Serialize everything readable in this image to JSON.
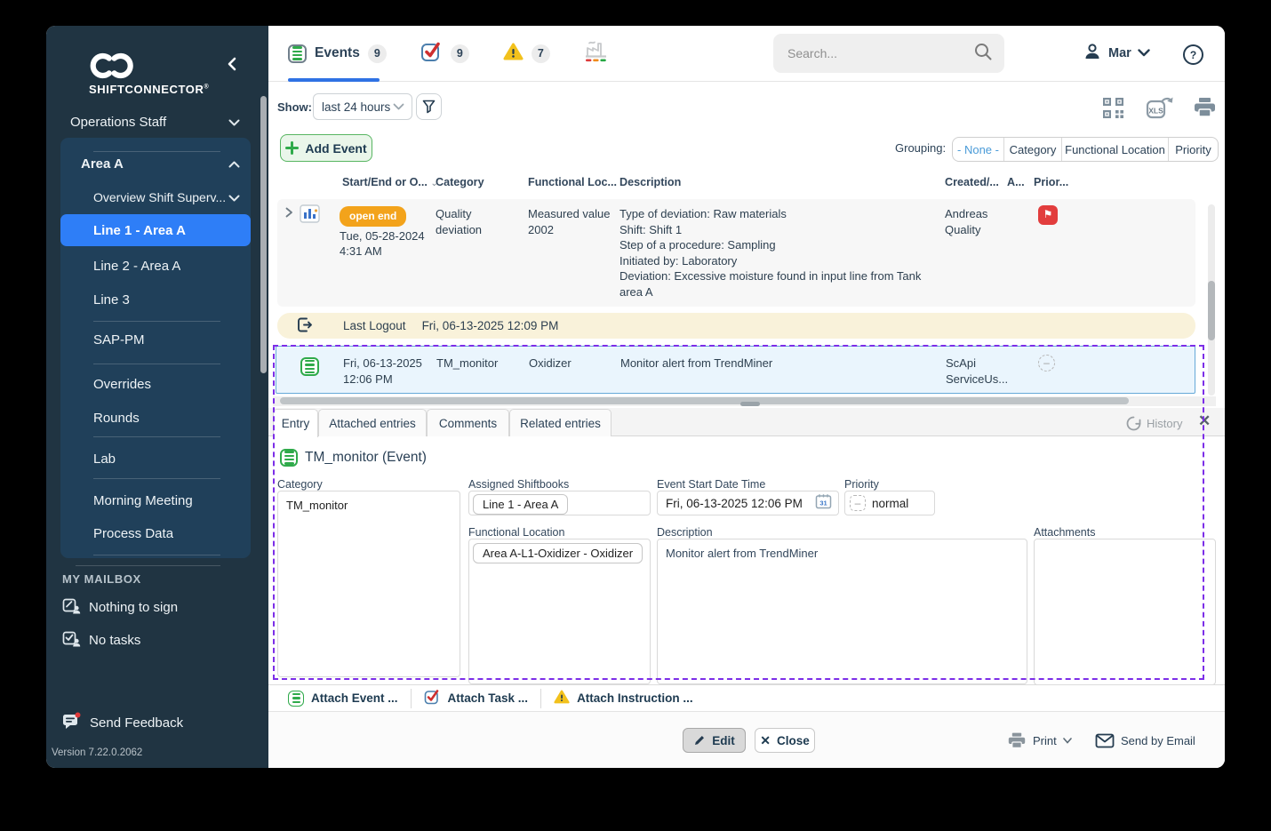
{
  "sidebar": {
    "brand": "SHIFTCONNECTOR",
    "brand_mark": "®",
    "operations": "Operations Staff",
    "group_header": "Area A",
    "overview": "Overview Shift Superv...",
    "line1": "Line 1 - Area A",
    "line2": "Line 2 - Area A",
    "line3": "Line 3",
    "sap": "SAP-PM",
    "overrides": "Overrides",
    "rounds": "Rounds",
    "lab": "Lab",
    "morning": "Morning Meeting",
    "process": "Process Data",
    "mailbox_header": "MY MAILBOX",
    "mailbox_sign": "Nothing to sign",
    "mailbox_tasks": "No tasks",
    "feedback": "Send Feedback",
    "version": "Version 7.22.0.2062"
  },
  "header": {
    "tab_events": "Events",
    "tab_events_count": "9",
    "tab_tasks_count": "9",
    "tab_warnings_count": "7",
    "search_placeholder": "Search...",
    "user_name": "Mar"
  },
  "toolbar": {
    "show_label": "Show:",
    "show_value": "last 24 hours",
    "add_event": "Add Event",
    "grouping_label": "Grouping:",
    "grouping_none": "- None -",
    "grouping_category": "Category",
    "grouping_functional": "Functional Location",
    "grouping_priority": "Priority"
  },
  "table": {
    "col_start": "Start/End or O...",
    "col_category": "Category",
    "col_functional": "Functional Loc...",
    "col_description": "Description",
    "col_created": "Created/...",
    "col_attachments": "A...",
    "col_priority": "Prior...",
    "row1": {
      "badge": "open end",
      "date": "Tue, 05-28-2024",
      "time": "4:31 AM",
      "category": "Quality deviation",
      "functional": "Measured value 2002",
      "description": "Type of deviation: Raw materials\nShift: Shift 1\nStep of a procedure: Sampling\nInitiated by: Laboratory\nDeviation: Excessive moisture found in input line from Tank area A",
      "created": "Andreas Quality"
    },
    "logout_label": "Last Logout",
    "logout_value": "Fri, 06-13-2025 12:09 PM",
    "selected_row": {
      "date": "Fri, 06-13-2025",
      "time": "12:06 PM",
      "category": "TM_monitor",
      "functional": "Oxidizer",
      "description": "Monitor alert from TrendMiner",
      "created": "ScApi ServiceUs..."
    }
  },
  "detail": {
    "tab_entry": "Entry",
    "tab_attached": "Attached entries",
    "tab_comments": "Comments",
    "tab_related": "Related entries",
    "history": "History",
    "title": "TM_monitor (Event)",
    "label_category": "Category",
    "value_category": "TM_monitor",
    "label_shiftbooks": "Assigned Shiftbooks",
    "value_shiftbooks": "Line 1 - Area A",
    "label_start": "Event Start Date Time",
    "value_start": "Fri, 06-13-2025 12:06 PM",
    "calendar_day": "31",
    "label_priority": "Priority",
    "value_priority": "normal",
    "label_functional": "Functional Location",
    "value_functional": "Area A-L1-Oxidizer - Oxidizer",
    "label_description": "Description",
    "value_description": "Monitor alert from TrendMiner",
    "label_attachments": "Attachments",
    "attach_event": "Attach Event ...",
    "attach_task": "Attach Task ...",
    "attach_instruction": "Attach Instruction ..."
  },
  "footer": {
    "edit": "Edit",
    "close": "Close",
    "print": "Print",
    "send_email": "Send by Email"
  },
  "icons": {
    "sort_chevron": "⌄",
    "close_x": "✕",
    "minus": "–",
    "flag": "⚑"
  }
}
